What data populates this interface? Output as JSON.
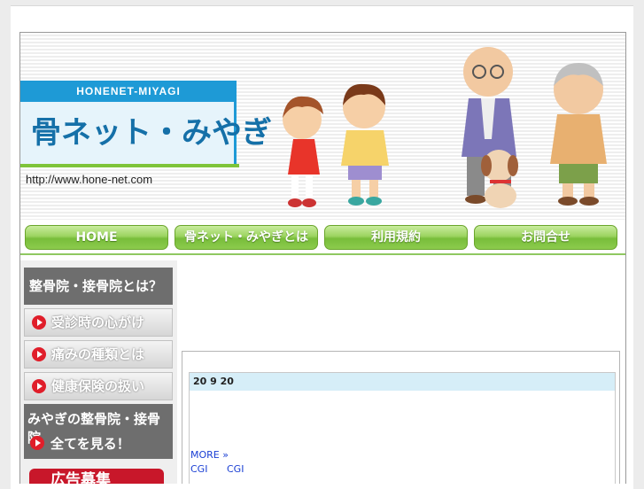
{
  "header": {
    "logo_sub": "HONENET-MIYAGI",
    "logo_title": "骨ネット・みやぎ",
    "url": "http://www.hone-net.com"
  },
  "nav": {
    "items": [
      "HOME",
      "骨ネット・みやぎとは",
      "利用規約",
      "お問合せ"
    ]
  },
  "sidebar": {
    "heading": "整骨院・接骨院とは？",
    "items": [
      "受診時の心がけ",
      "痛みの種類とは",
      "健康保険の扱い"
    ],
    "block_title": "みやぎの整骨院・接骨院",
    "block_link": "全てを見る！",
    "ad_label": "広告募集"
  },
  "news": {
    "date": "20 9 20",
    "more": "MORE »",
    "links": [
      "CGI",
      "CGI"
    ]
  },
  "colors": {
    "accent_blue": "#1e9ad6",
    "nav_green": "#8ccb4d",
    "arrow_red": "#e01e2a"
  }
}
